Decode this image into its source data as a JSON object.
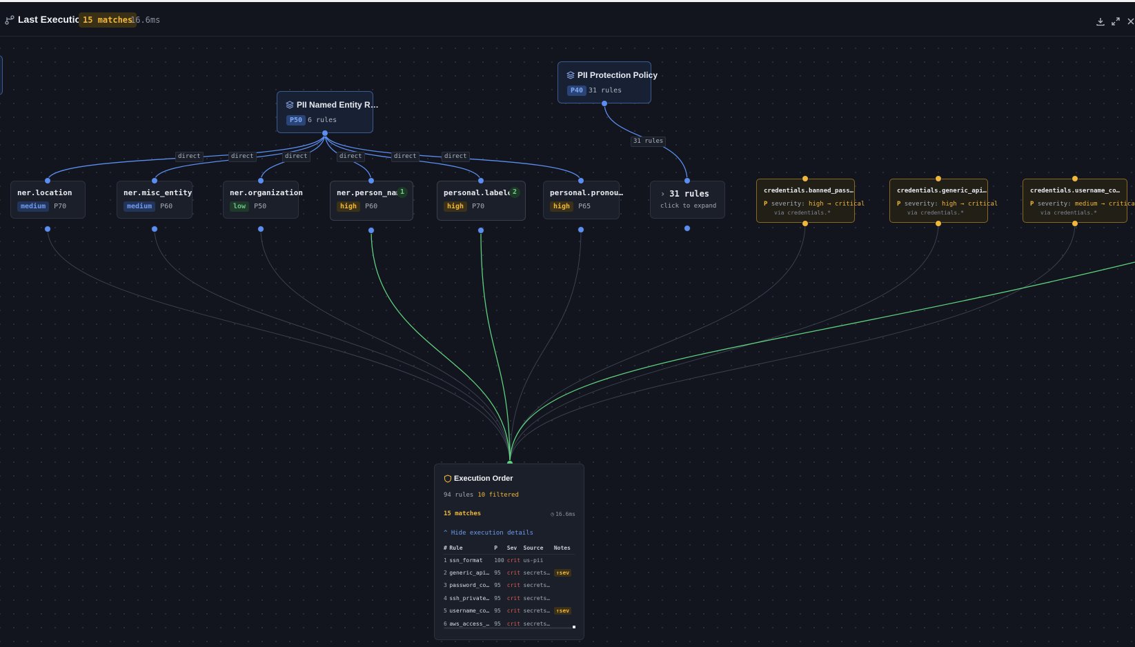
{
  "header": {
    "title": "Last Execution",
    "matches_badge": "15 matches",
    "time": "16.6ms"
  },
  "groups": [
    {
      "title": "PII Named Entity R…",
      "priority": "P50",
      "rules": "6 rules"
    },
    {
      "title": "PII Protection Policy",
      "priority": "P40",
      "rules": "31 rules"
    }
  ],
  "edge_labels": {
    "direct": "direct",
    "rules31": "31 rules"
  },
  "rule_nodes": [
    {
      "name": "ner.location",
      "severity": "medium",
      "priority": "P70"
    },
    {
      "name": "ner.misc_entity",
      "severity": "medium",
      "priority": "P60"
    },
    {
      "name": "ner.organization",
      "severity": "low",
      "priority": "P50"
    },
    {
      "name": "ner.person_name",
      "severity": "high",
      "priority": "P60",
      "matches": "1"
    },
    {
      "name": "personal.labele…",
      "severity": "high",
      "priority": "P70",
      "matches": "2"
    },
    {
      "name": "personal.pronou…",
      "severity": "high",
      "priority": "P65"
    }
  ],
  "collapsed": {
    "title": "31 rules",
    "hint": "click to expand"
  },
  "credentials": [
    {
      "name": "credentials.banned_pass…",
      "prefix": "P",
      "label": "severity:",
      "value": "high → critical",
      "via": "via credentials.*"
    },
    {
      "name": "credentials.generic_api…",
      "prefix": "P",
      "label": "severity:",
      "value": "high → critical",
      "via": "via credentials.*"
    },
    {
      "name": "credentials.username_co…",
      "prefix": "P",
      "label": "severity:",
      "value": "medium → critical",
      "via": "via credentials.*"
    }
  ],
  "execution": {
    "title": "Execution Order",
    "rules": "94 rules",
    "filtered": "10 filtered",
    "matches": "15 matches",
    "time": "16.6ms",
    "toggle": "^ Hide execution details",
    "columns": [
      "#",
      "Rule",
      "P",
      "Sev",
      "Source",
      "Notes"
    ],
    "rows": [
      {
        "n": "1",
        "rule": "ssn_format",
        "p": "100",
        "sev": "crit",
        "source": "us-pii",
        "note": ""
      },
      {
        "n": "2",
        "rule": "generic_api…",
        "p": "95",
        "sev": "crit",
        "source": "secrets…",
        "note": "↑sev"
      },
      {
        "n": "3",
        "rule": "password_co…",
        "p": "95",
        "sev": "crit",
        "source": "secrets…",
        "note": ""
      },
      {
        "n": "4",
        "rule": "ssh_private…",
        "p": "95",
        "sev": "crit",
        "source": "secrets…",
        "note": ""
      },
      {
        "n": "5",
        "rule": "username_co…",
        "p": "95",
        "sev": "crit",
        "source": "secrets…",
        "note": "↑sev"
      },
      {
        "n": "6",
        "rule": "aws_access_…",
        "p": "95",
        "sev": "crit",
        "source": "secrets…",
        "note": ""
      }
    ]
  },
  "colors": {
    "background": "#12151d",
    "edge_blue": "#5b8ef0",
    "edge_green": "#5fd07f",
    "edge_gray": "#3b4150",
    "accent_amber": "#f0b73a",
    "crit_red": "#e05b52"
  }
}
